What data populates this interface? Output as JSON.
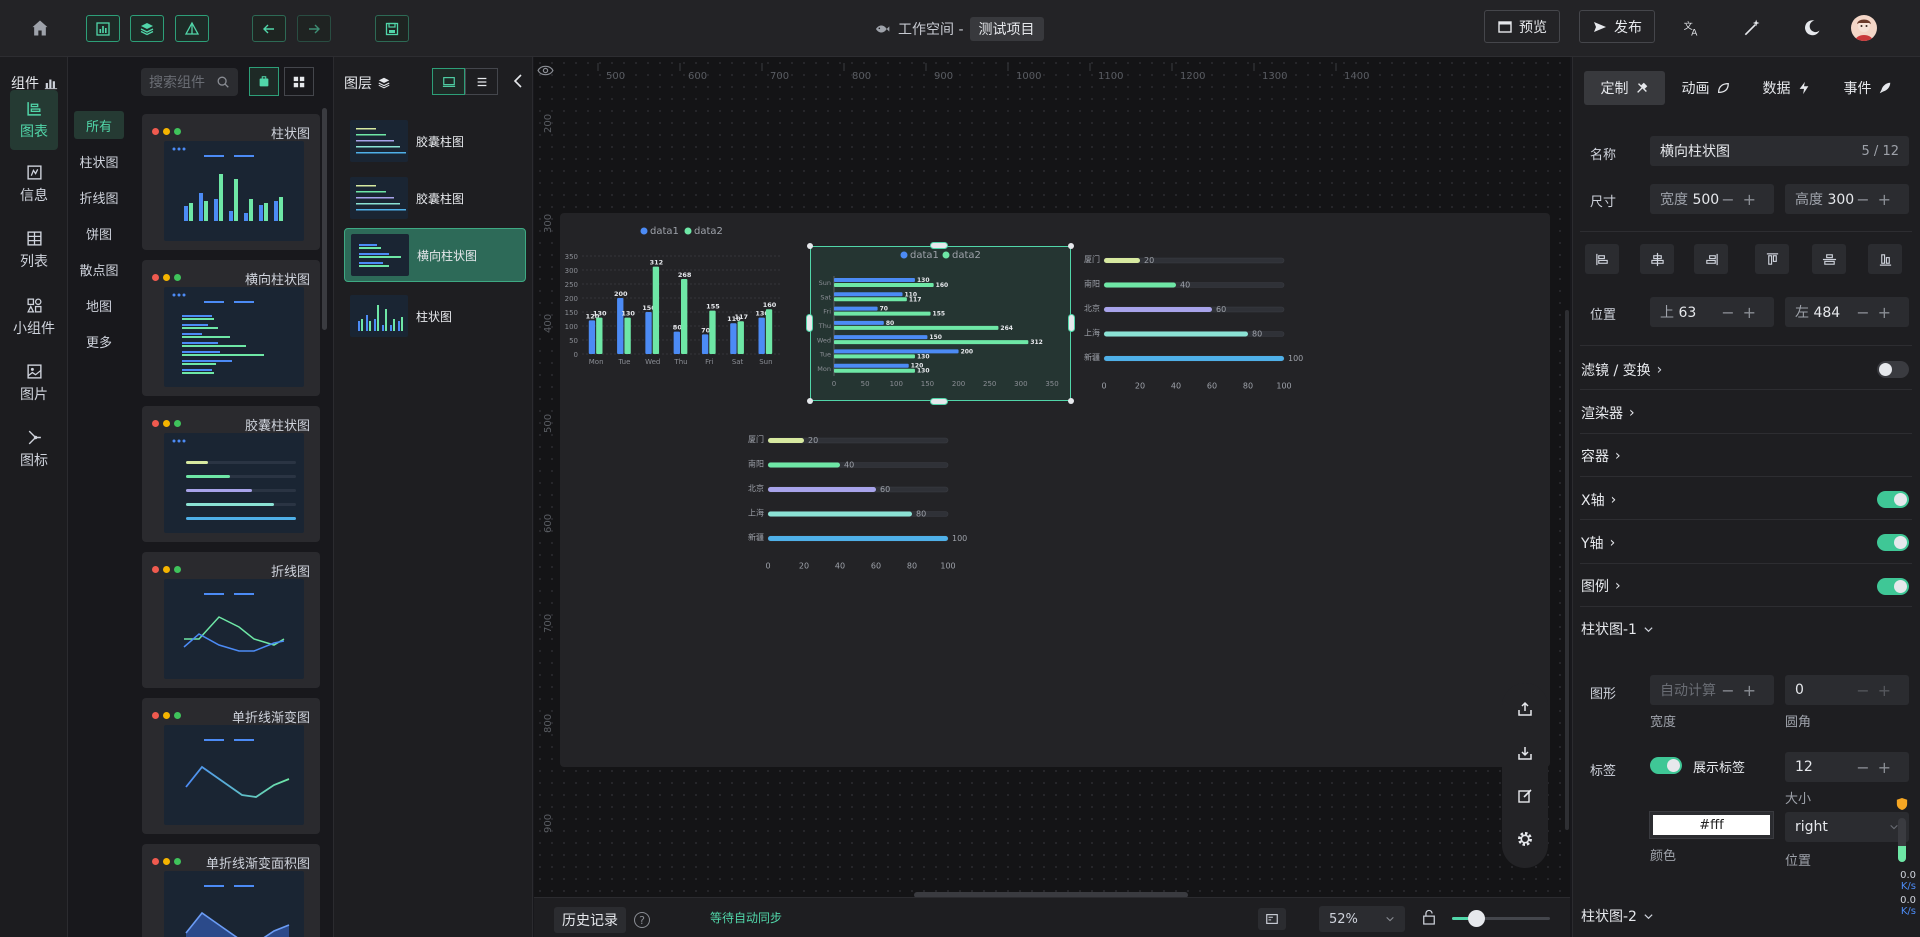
{
  "header": {
    "workspace_label": "工作空间 -",
    "project_name": "测试项目",
    "preview_label": "预览",
    "publish_label": "发布"
  },
  "rail": {
    "items": [
      {
        "label": "图表",
        "icon": "bar-chart-icon",
        "active": true
      },
      {
        "label": "信息",
        "icon": "info-icon"
      },
      {
        "label": "列表",
        "icon": "table-icon"
      },
      {
        "label": "小组件",
        "icon": "widget-icon"
      },
      {
        "label": "图片",
        "icon": "image-icon"
      },
      {
        "label": "图标",
        "icon": "icon-icon"
      }
    ]
  },
  "components": {
    "title": "组件",
    "search_placeholder": "搜索组件",
    "categories": [
      "所有",
      "柱状图",
      "折线图",
      "饼图",
      "散点图",
      "地图",
      "更多"
    ],
    "cards": [
      "柱状图",
      "横向柱状图",
      "胶囊柱状图",
      "折线图",
      "单折线渐变图",
      "单折线渐变面积图"
    ]
  },
  "layers": {
    "title": "图层",
    "items": [
      "胶囊柱图",
      "胶囊柱图",
      "横向柱状图",
      "柱状图"
    ]
  },
  "canvas": {
    "ruler_top": [
      "500",
      "600",
      "700",
      "800",
      "900",
      "1000",
      "1100",
      "1200",
      "1300",
      "1400"
    ],
    "ruler_left": [
      "200",
      "300",
      "400",
      "500",
      "600",
      "700",
      "800",
      "900"
    ]
  },
  "chart_data": [
    {
      "type": "bar",
      "legend": [
        "data1",
        "data2"
      ],
      "categories": [
        "Mon",
        "Tue",
        "Wed",
        "Thu",
        "Fri",
        "Sat",
        "Sun"
      ],
      "series": [
        {
          "name": "data1",
          "values": [
            120,
            200,
            150,
            80,
            70,
            110,
            130
          ]
        },
        {
          "name": "data2",
          "values": [
            130,
            130,
            312,
            268,
            155,
            117,
            160
          ]
        }
      ],
      "y_ticks": [
        "0",
        "50",
        "100",
        "150",
        "200",
        "250",
        "300",
        "350"
      ],
      "ylim": [
        0,
        350
      ],
      "colors": [
        "#4c8bf5",
        "#6ee7a6"
      ]
    },
    {
      "type": "bar",
      "orientation": "horizontal",
      "legend": [
        "data1",
        "data2"
      ],
      "categories": [
        "Mon",
        "Tue",
        "Wed",
        "Thu",
        "Fri",
        "Sat",
        "Sun"
      ],
      "series": [
        {
          "name": "data1",
          "values": [
            120,
            200,
            150,
            80,
            70,
            110,
            130
          ]
        },
        {
          "name": "data2",
          "values": [
            130,
            130,
            312,
            264,
            155,
            117,
            160
          ]
        }
      ],
      "x_ticks": [
        "0",
        "50",
        "100",
        "150",
        "200",
        "250",
        "300",
        "350"
      ],
      "xlim": [
        0,
        350
      ],
      "colors": [
        "#4c8bf5",
        "#6ee7a6"
      ]
    },
    {
      "type": "bar",
      "orientation": "horizontal",
      "style": "capsule",
      "categories": [
        "厦门",
        "南阳",
        "北京",
        "上海",
        "新疆"
      ],
      "values": [
        20,
        40,
        60,
        80,
        100
      ],
      "x_ticks": [
        "0",
        "20",
        "40",
        "60",
        "80",
        "100"
      ],
      "xlim": [
        0,
        100
      ],
      "colors": [
        "#d7e9a0",
        "#6ee7a6",
        "#a8a3ea",
        "#8be2d4",
        "#4fb0e8"
      ]
    },
    {
      "type": "bar",
      "orientation": "horizontal",
      "style": "capsule",
      "categories": [
        "厦门",
        "南阳",
        "北京",
        "上海",
        "新疆"
      ],
      "values": [
        20,
        40,
        60,
        80,
        100
      ],
      "x_ticks": [
        "0",
        "20",
        "40",
        "60",
        "80",
        "100"
      ],
      "xlim": [
        0,
        100
      ],
      "colors": [
        "#d7e9a0",
        "#6ee7a6",
        "#a8a3ea",
        "#8be2d4",
        "#4fb0e8"
      ]
    }
  ],
  "bottombar": {
    "history_label": "历史记录",
    "sync_status": "等待自动同步",
    "zoom": "52%"
  },
  "props": {
    "tabs": [
      "定制",
      "动画",
      "数据",
      "事件"
    ],
    "name_label": "名称",
    "name_value": "横向柱状图",
    "name_count": "5 / 12",
    "size_label": "尺寸",
    "width_label": "宽度",
    "width_value": "500",
    "height_label": "高度",
    "height_value": "300",
    "position_label": "位置",
    "top_label": "上",
    "top_value": "63",
    "left_label": "左",
    "left_value": "484",
    "sections": [
      "滤镜 / 变换",
      "渲染器",
      "容器",
      "X轴",
      "Y轴",
      "图例"
    ],
    "series1_title": "柱状图-1",
    "series2_title": "柱状图-2",
    "shape_label": "图形",
    "shape_width_placeholder": "自动计算",
    "shape_width_sub": "宽度",
    "radius_value": "0",
    "radius_sub": "圆角",
    "tag_label": "标签",
    "show_label_text": "展示标签",
    "label_size": "12",
    "size_sub": "大小",
    "color_value": "#fff",
    "color_sub": "颜色",
    "position_value": "right",
    "position_sub": "位置"
  },
  "net": {
    "up": "0.0",
    "up_unit": "K/s",
    "down": "0.0",
    "down_unit": "K/s"
  }
}
